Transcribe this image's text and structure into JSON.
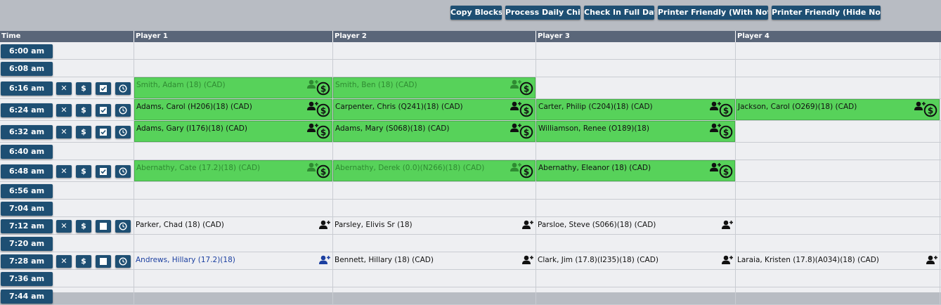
{
  "toolbar": {
    "copy_blocks": "Copy Blocks",
    "process_daily_chits": "Process Daily Chits",
    "check_in_full_day": "Check In Full Day",
    "printer_with_notes": "Printer Friendly (With Notes)",
    "printer_hide_notes": "Printer Friendly (Hide Notes)"
  },
  "columns": {
    "time": "Time",
    "player1": "Player 1",
    "player2": "Player 2",
    "player3": "Player 3",
    "player4": "Player 4"
  },
  "action_labels": {
    "delete": "✕",
    "pay": "$"
  },
  "colors": {
    "accent": "#1e4f73",
    "booked": "#57d25a",
    "header": "#5a6679"
  },
  "rows": [
    {
      "time": "6:00 am"
    },
    {
      "time": "6:08 am"
    },
    {
      "time": "6:16 am",
      "players": [
        "Smith, Adam (18)   (CAD)",
        "Smith, Ben (18)   (CAD)"
      ]
    },
    {
      "time": "6:24 am",
      "players": [
        "Adams, Carol (H206)(18)   (CAD)",
        "Carpenter, Chris (Q241)(18)   (CAD)",
        "Carter, Philip (C204)(18)   (CAD)",
        "Jackson, Carol (O269)(18)   (CAD)"
      ]
    },
    {
      "time": "6:32 am",
      "players": [
        "Adams, Gary (I176)(18)   (CAD)",
        "Adams, Mary (S068)(18)   (CAD)",
        "Williamson, Renee (O189)(18)"
      ]
    },
    {
      "time": "6:40 am"
    },
    {
      "time": "6:48 am",
      "players": [
        "Abernathy, Cate (17.2)(18)   (CAD)",
        "Abernathy, Derek (0.0)(N266)(18)   (CAD)",
        "Abernathy, Eleanor (18)   (CAD)"
      ]
    },
    {
      "time": "6:56 am"
    },
    {
      "time": "7:04 am"
    },
    {
      "time": "7:12 am",
      "players": [
        "Parker, Chad (18)   (CAD)",
        "Parsley, Elivis Sr (18)",
        "Parsloe, Steve (S066)(18)   (CAD)"
      ]
    },
    {
      "time": "7:20 am"
    },
    {
      "time": "7:28 am",
      "players": [
        "Andrews, Hillary (17.2)(18)",
        "Bennett, Hillary (18)   (CAD)",
        "Clark, Jim (17.8)(I235)(18)   (CAD)",
        "Laraia, Kristen (17.8)(A034)(18)   (CAD)"
      ]
    },
    {
      "time": "7:36 am"
    },
    {
      "time": "7:44 am"
    }
  ]
}
